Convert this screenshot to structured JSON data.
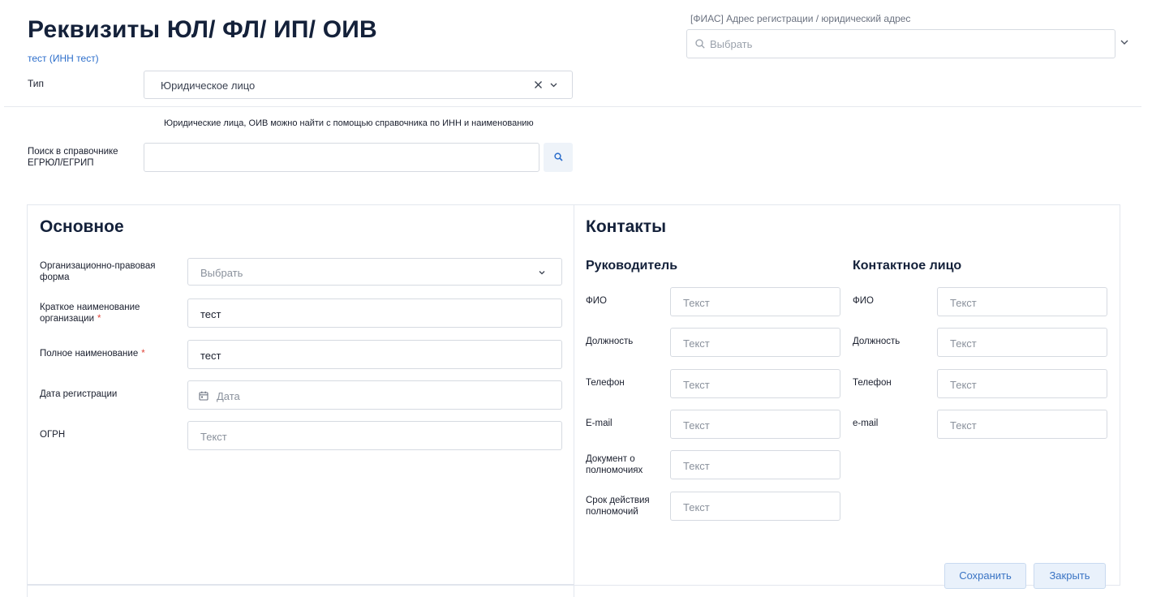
{
  "header": {
    "title": "Реквизиты ЮЛ/ ФЛ/ ИП/ ОИВ",
    "subtitle_link": "тест (ИНН тест)"
  },
  "fias": {
    "label": "[ФИАС] Адрес регистрации / юридический адрес",
    "placeholder": "Выбрать"
  },
  "type": {
    "label": "Тип",
    "value": "Юридическое лицо"
  },
  "hint": "Юридические лица, ОИВ можно найти с помощью справочника по ИНН и наименованию",
  "search": {
    "label": "Поиск в справочнике ЕГРЮЛ/ЕГРИП",
    "value": ""
  },
  "main": {
    "title": "Основное",
    "fields": {
      "opf": {
        "label": "Организационно-правовая форма",
        "placeholder": "Выбрать"
      },
      "short_name": {
        "label": "Краткое наименование организации",
        "value": "тест",
        "required": "*"
      },
      "full_name": {
        "label": "Полное наименование",
        "value": "тест",
        "required": "*"
      },
      "reg_date": {
        "label": "Дата регистрации",
        "placeholder": "Дата"
      },
      "ogrn": {
        "label": "ОГРН",
        "placeholder": "Текст"
      }
    }
  },
  "contacts": {
    "title": "Контакты",
    "head": {
      "title": "Руководитель",
      "fio": {
        "label": "ФИО",
        "placeholder": "Текст"
      },
      "position": {
        "label": "Должность",
        "placeholder": "Текст"
      },
      "phone": {
        "label": "Телефон",
        "placeholder": "Текст"
      },
      "email": {
        "label": "E-mail",
        "placeholder": "Текст"
      },
      "authority_doc": {
        "label": "Документ о полномочиях",
        "placeholder": "Текст"
      },
      "authority_term": {
        "label": "Срок действия полномочий",
        "placeholder": "Текст"
      }
    },
    "contact_person": {
      "title": "Контактное лицо",
      "fio": {
        "label": "ФИО",
        "placeholder": "Текст"
      },
      "position": {
        "label": "Должность",
        "placeholder": "Текст"
      },
      "phone": {
        "label": "Телефон",
        "placeholder": "Текст"
      },
      "email": {
        "label": "e-mail",
        "placeholder": "Текст"
      }
    }
  },
  "actions": {
    "save": "Сохранить",
    "close": "Закрыть"
  },
  "colors": {
    "title": "#14213a",
    "link": "#2c6ecb",
    "required": "#e0453a",
    "button_bg": "#e9f1fb",
    "button_text": "#3a74c4"
  }
}
